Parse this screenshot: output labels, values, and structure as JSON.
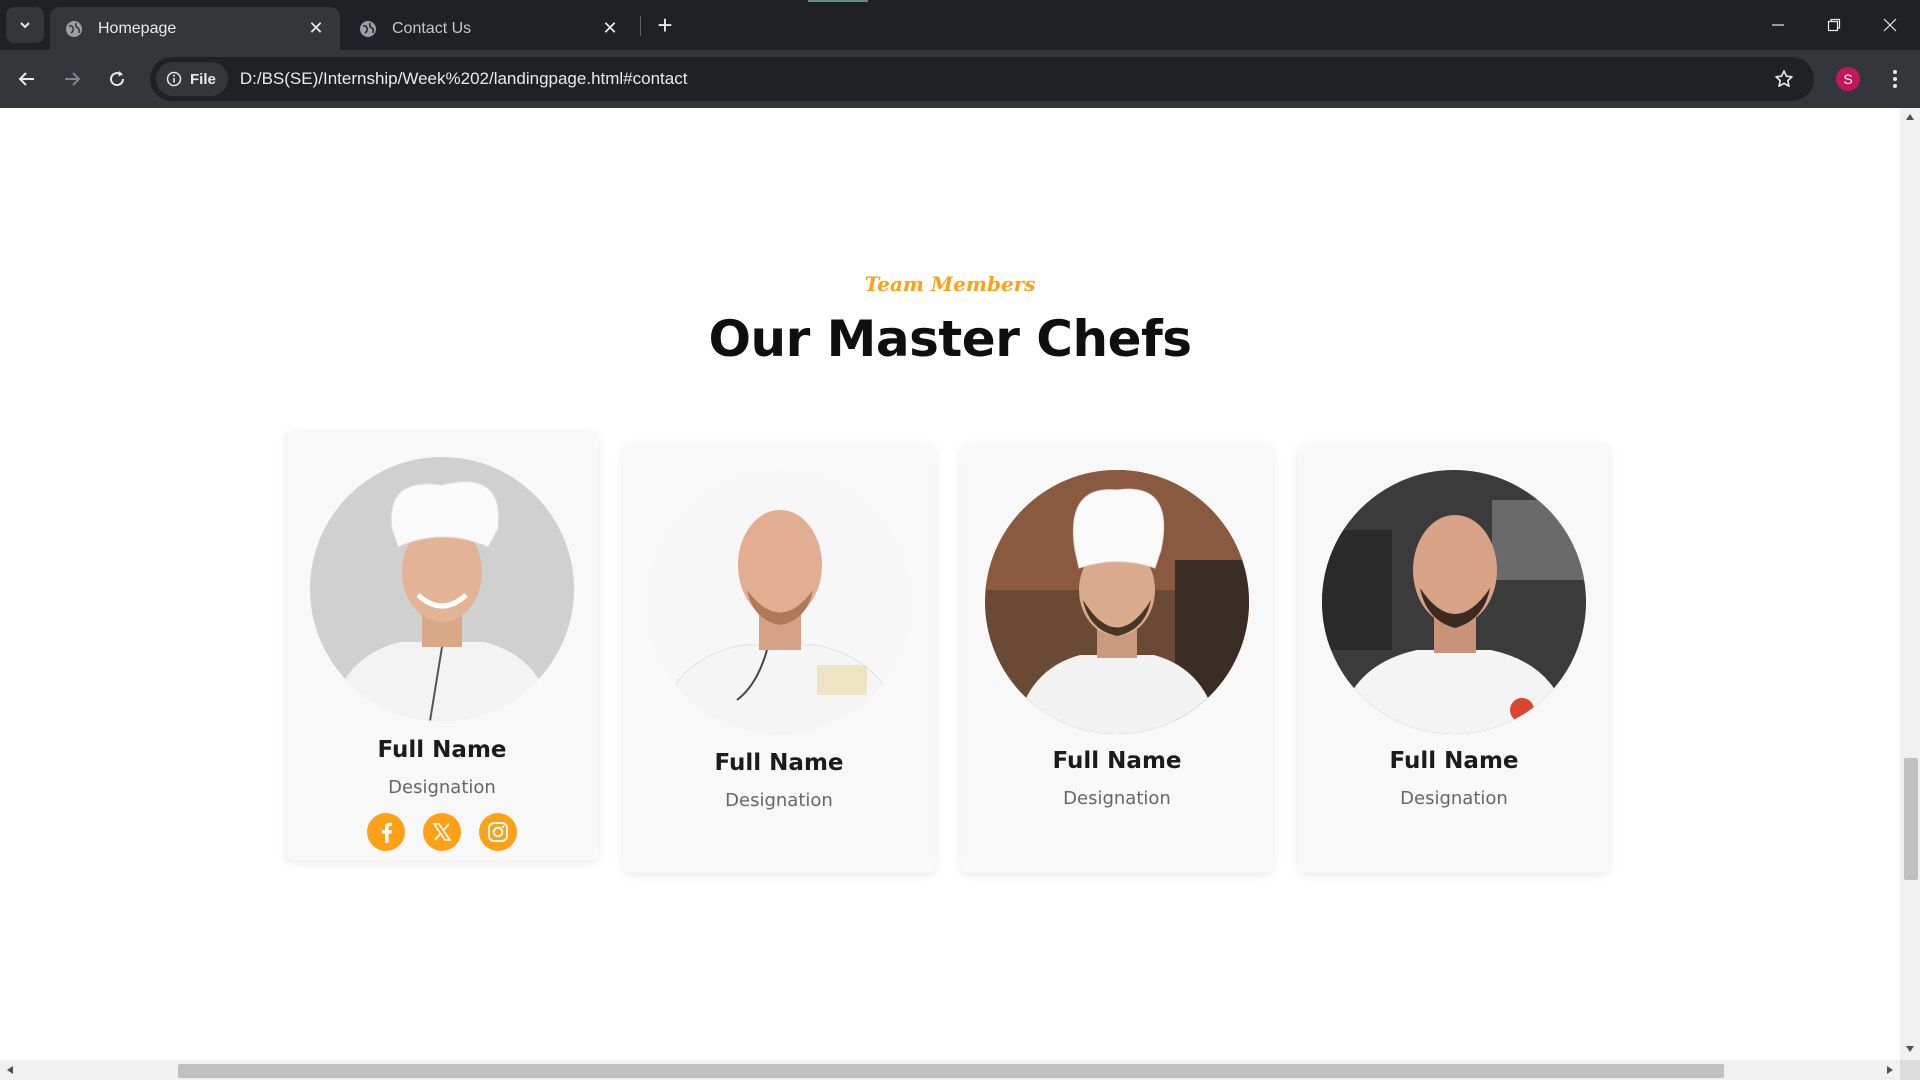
{
  "browser": {
    "tabs": [
      {
        "title": "Homepage",
        "active": true
      },
      {
        "title": "Contact Us",
        "active": false
      }
    ],
    "security_chip": "File",
    "url": "D:/BS(SE)/Internship/Week%202/landingpage.html#contact",
    "profile_initial": "S"
  },
  "section": {
    "subtitle": "Team Members",
    "title": "Our Master Chefs"
  },
  "chefs": [
    {
      "name": "Full Name",
      "designation": "Designation",
      "photo": "chef-smiling-toque-grey-backdrop"
    },
    {
      "name": "Full Name",
      "designation": "Designation",
      "photo": "bald-chef-temecula-catering-jacket"
    },
    {
      "name": "Full Name",
      "designation": "Designation",
      "photo": "bearded-chef-toque-brick-wall"
    },
    {
      "name": "Full Name",
      "designation": "Designation",
      "photo": "bald-bearded-chef-kitchen"
    }
  ],
  "socials": [
    "facebook-icon",
    "x-icon",
    "instagram-icon"
  ],
  "colors": {
    "accent": "#fea116",
    "heading": "#0f0f0f",
    "card_bg": "#f8f8f8",
    "chrome_dark": "#202124",
    "chrome_mid": "#35363a"
  }
}
